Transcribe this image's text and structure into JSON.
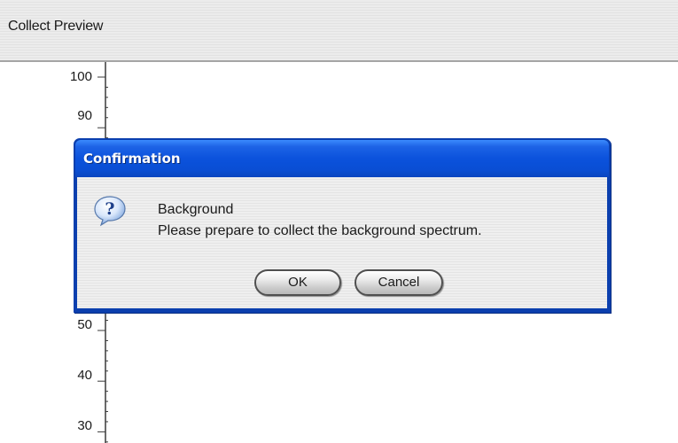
{
  "app": {
    "title": "Collect Preview"
  },
  "axis": {
    "tick_labels": [
      "100",
      "90",
      "50",
      "40",
      "30"
    ]
  },
  "dialog": {
    "title": "Confirmation",
    "icon": "question-icon",
    "heading": "Background",
    "message": "Please prepare to collect the background spectrum.",
    "ok_label": "OK",
    "cancel_label": "Cancel"
  },
  "colors": {
    "titlebar": "#0b52dc",
    "dialog_border": "#0b3fae"
  }
}
